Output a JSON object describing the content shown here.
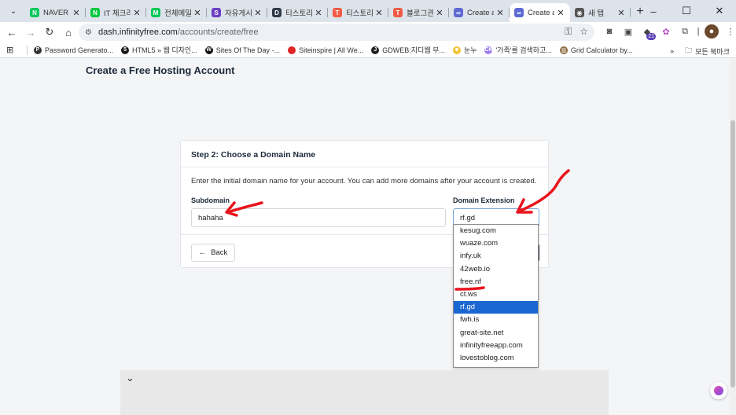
{
  "tabs": [
    {
      "title": "NAVER",
      "color": "#03c75a",
      "letter": "N"
    },
    {
      "title": "IT 체크리",
      "color": "#00c73c",
      "letter": "N"
    },
    {
      "title": "전체메일",
      "color": "#03c75a",
      "letter": "M"
    },
    {
      "title": "자유게시",
      "color": "#6a3ec2",
      "letter": "S"
    },
    {
      "title": "티스토리",
      "color": "#2f3a48",
      "letter": "D"
    },
    {
      "title": "티스토리",
      "color": "#f25a45",
      "letter": "T"
    },
    {
      "title": "블로그관",
      "color": "#f25a45",
      "letter": "T"
    },
    {
      "title": "Create a",
      "color": "#5e6ad2",
      "letter": "∞"
    },
    {
      "title": "Create a",
      "color": "#5e6ad2",
      "letter": "∞",
      "active": true
    },
    {
      "title": "새 탭",
      "color": "#555555",
      "letter": "◉"
    }
  ],
  "address": {
    "domain": "dash.infinityfree.com",
    "path": "/accounts/create/free"
  },
  "bookmarks": [
    {
      "label": "Password Generato...",
      "color": "#333333",
      "icon": "P"
    },
    {
      "label": "HTML5 » 웹 디자인...",
      "color": "#1b1b1b",
      "icon": "5"
    },
    {
      "label": "Sites Of The Day -...",
      "color": "#111111",
      "icon": "W"
    },
    {
      "label": "Siteinspire | All We...",
      "color": "#e02424",
      "icon": ""
    },
    {
      "label": "GDWEB:지디웹 무...",
      "color": "#222222",
      "icon": "J"
    },
    {
      "label": "눈누",
      "color": "#f2c230",
      "icon": "☻"
    },
    {
      "label": "'가족'를 검색하고...",
      "color": "#a07ef0",
      "icon": "CK"
    },
    {
      "label": "Grid Calculator by...",
      "color": "#8b6b3d",
      "icon": "▥"
    }
  ],
  "bookmarks_all": "모든 북마크",
  "page": {
    "title": "Create a Free Hosting Account",
    "step_title": "Step 2: Choose a Domain Name",
    "description": "Enter the initial domain name for your account. You can add more domains after your account is created.",
    "subdomain_label": "Subdomain",
    "subdomain_value": "hahaha",
    "extension_label": "Domain Extension",
    "extension_value": "rf.gd",
    "back_label": "Back",
    "options": [
      "kesug.com",
      "wuaze.com",
      "infy.uk",
      "42web.io",
      "free.nf",
      "ct.ws",
      "rf.gd",
      "fwh.is",
      "great-site.net",
      "infinityfreeapp.com",
      "lovestoblog.com"
    ],
    "selected_option": "rf.gd"
  },
  "colors": {
    "accent": "#1a67d2",
    "annotation": "#e8141d"
  }
}
